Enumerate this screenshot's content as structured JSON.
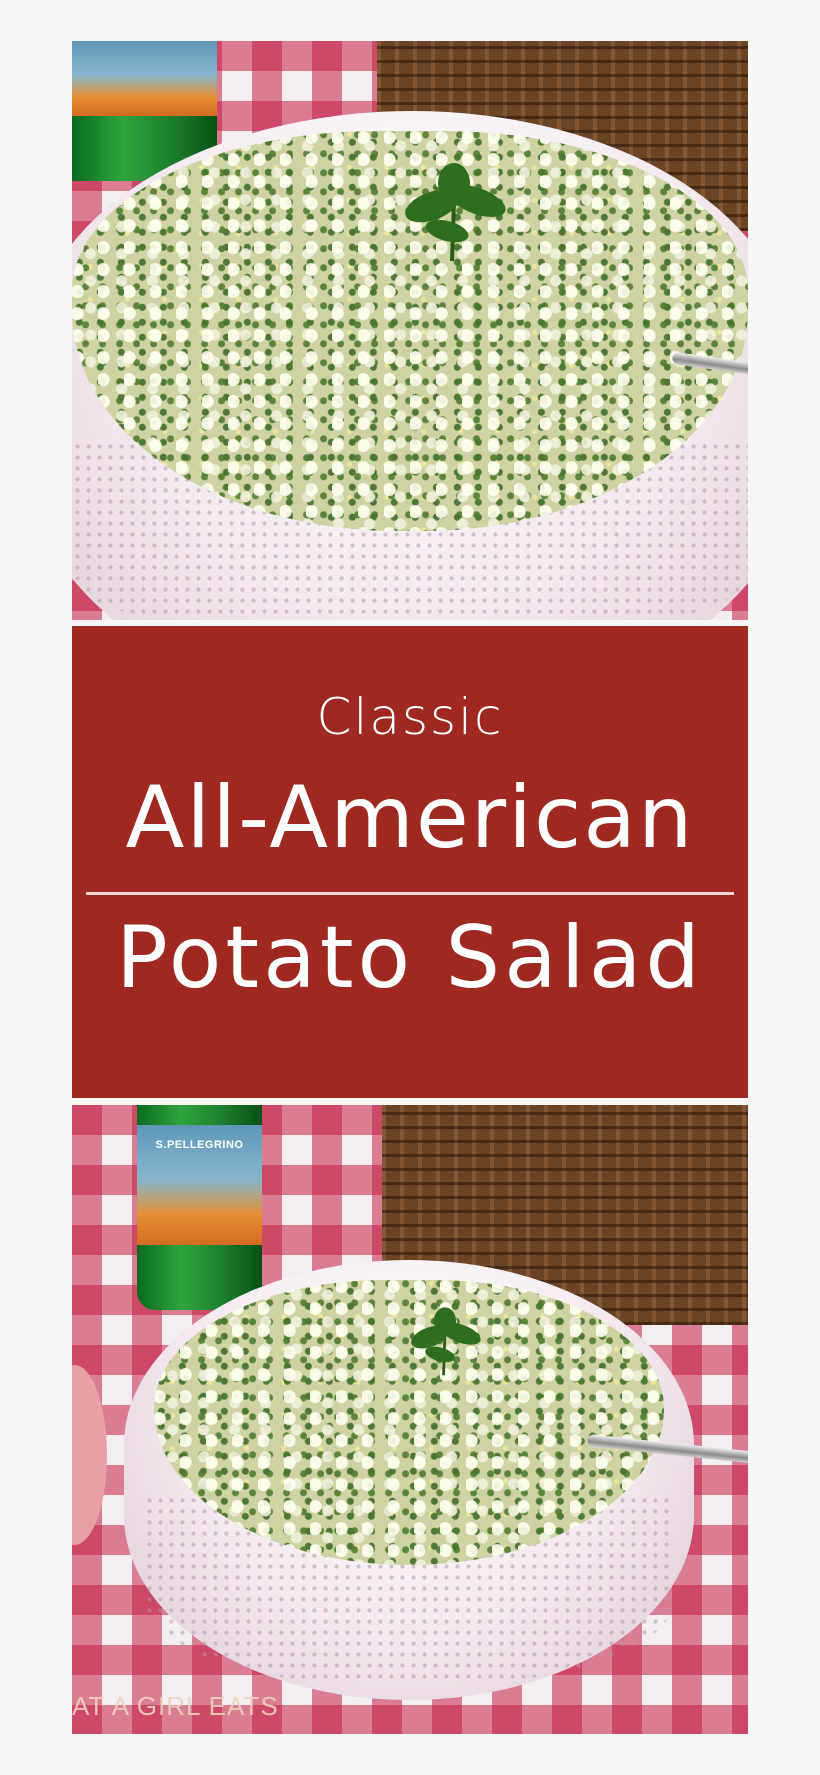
{
  "title": {
    "line1": "Classic",
    "line2": "All-American",
    "line3": "Potato Salad"
  },
  "watermark": "AT A GIRL EATS",
  "bottle_label": "S.PELLEGRINO",
  "colors": {
    "banner": "#9f2820",
    "banner_text": "#ffffff",
    "tablecloth_red": "#c41e46",
    "tablecloth_white": "#f3eef0",
    "page_background": "#f7f7f7"
  },
  "icons": {
    "parsley": "parsley-garnish-icon",
    "spoon": "serving-spoon-icon"
  }
}
